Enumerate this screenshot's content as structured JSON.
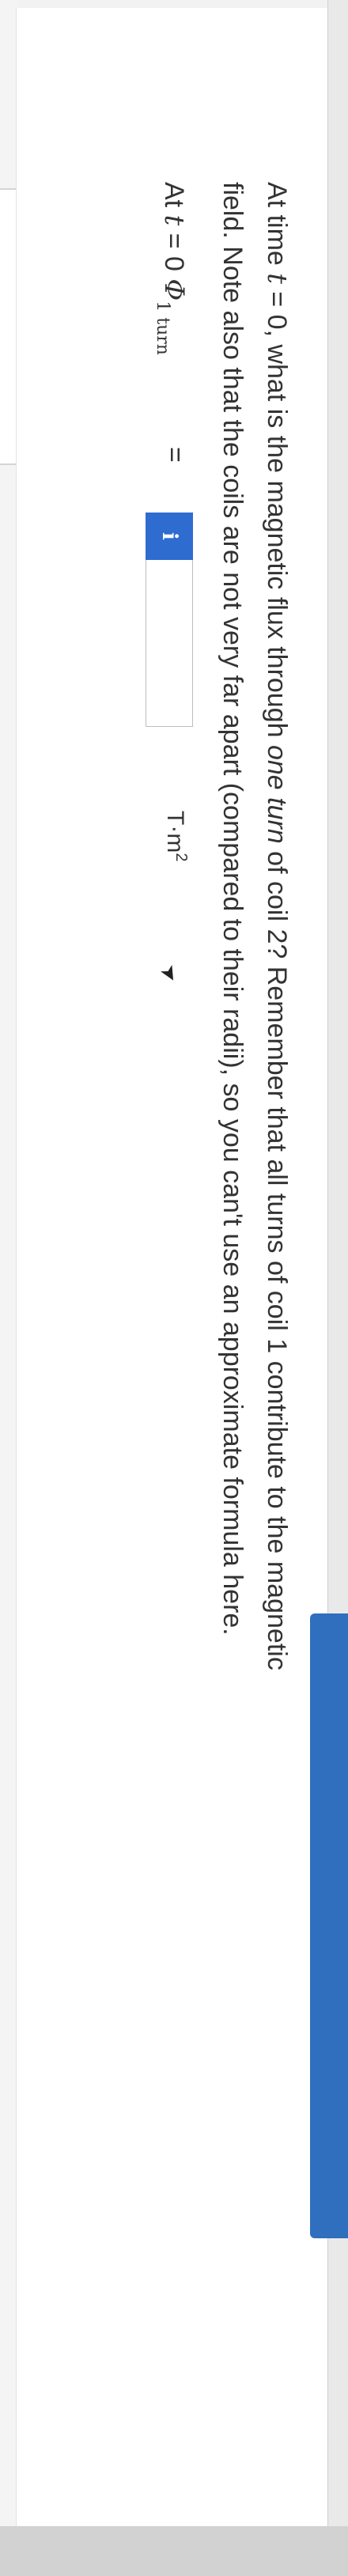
{
  "question": {
    "prompt_line1_a": "At time ",
    "prompt_line1_t": "t",
    "prompt_line1_b": " = 0, what is the magnetic flux through ",
    "prompt_line1_ital": "one turn",
    "prompt_line1_c": " of coil 2? Remember that all turns of coil 1 contribute to the magnetic",
    "prompt_line2": "field. Note also that the coils are not very far apart (compared to their radii), so you can't use an approximate formula here."
  },
  "answer": {
    "label_at": "At ",
    "label_t": "t",
    "label_eq0": " = 0 ",
    "label_phi": "Φ",
    "label_sub": "1 turn",
    "equals": "=",
    "info_glyph": "i",
    "value": "",
    "unit": "T·m",
    "unit_exp": "2"
  },
  "colors": {
    "info_badge": "#2e6cd0",
    "side_tab": "#2f6fbe"
  },
  "icons": {
    "cursor": "mouse-cursor-icon",
    "info": "info-icon"
  }
}
